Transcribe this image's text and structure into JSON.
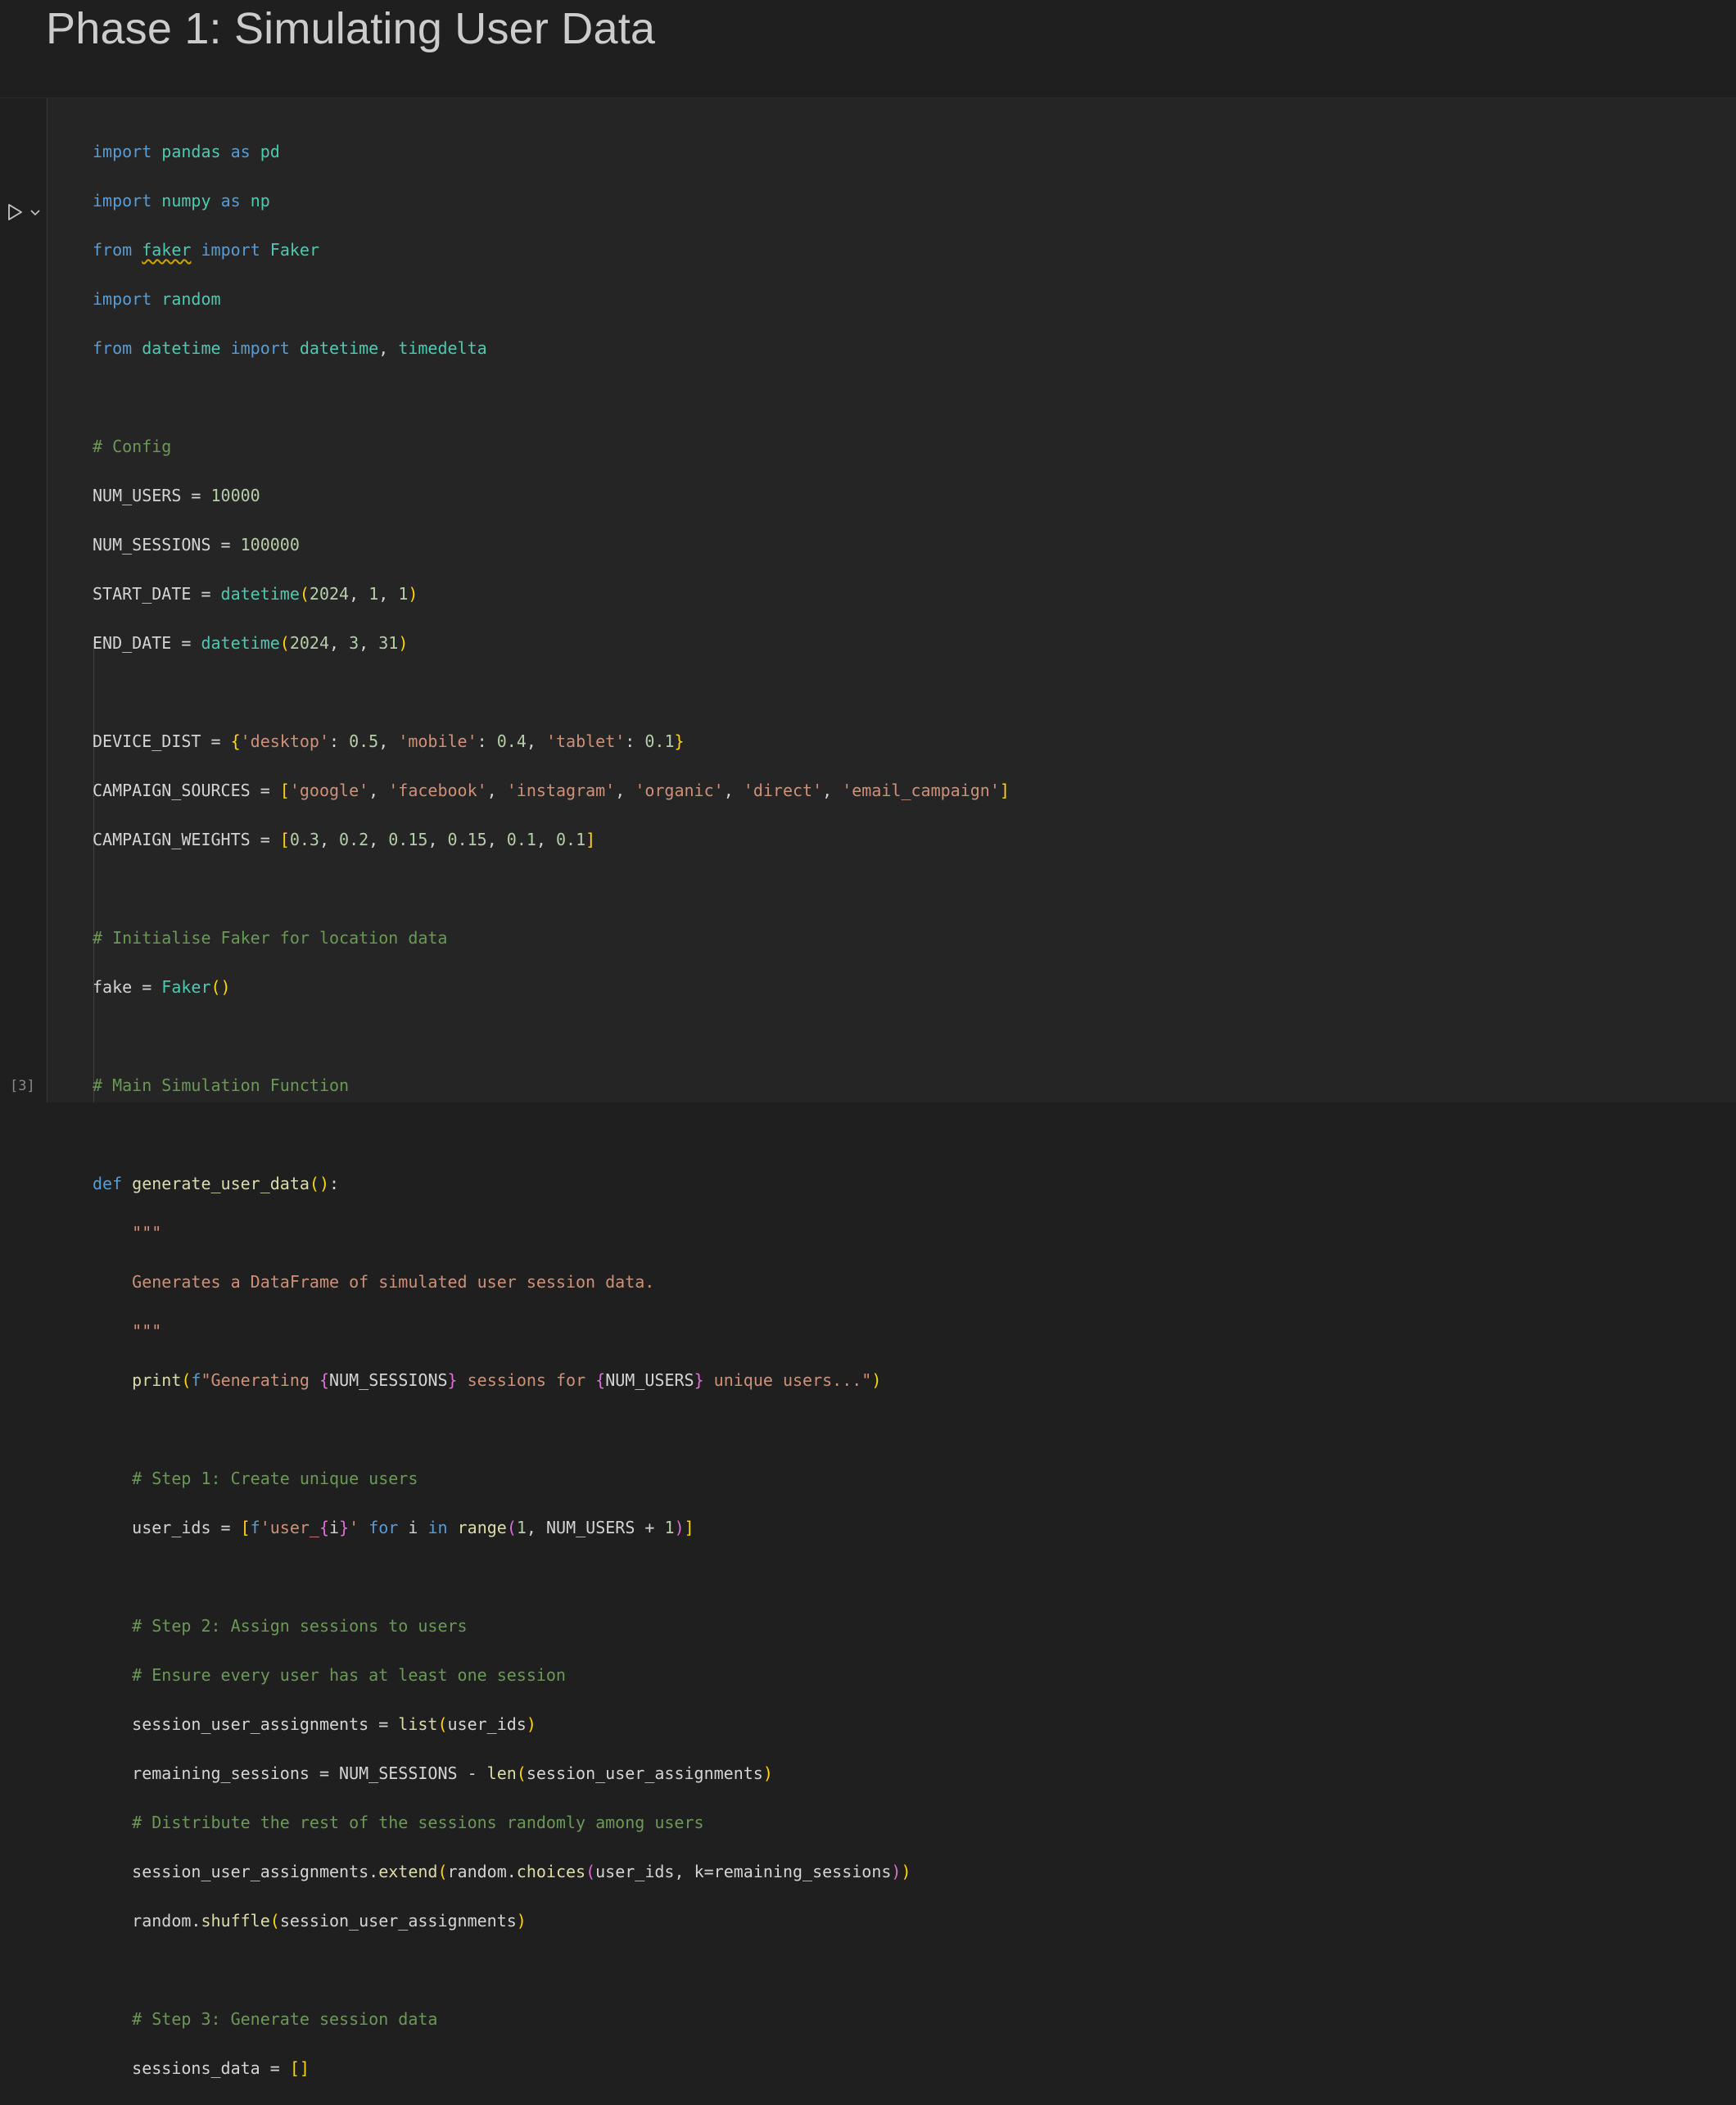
{
  "heading": {
    "title": "Phase 1: Simulating User Data"
  },
  "cell": {
    "execution_count": "[3]",
    "tokens": {
      "import": "import",
      "from": "from",
      "as": "as",
      "def": "def",
      "for": "for",
      "in": "in",
      "pandas": "pandas",
      "pd": "pd",
      "numpy": "numpy",
      "np": "np",
      "faker": "faker",
      "Faker": "Faker",
      "random": "random",
      "datetime": "datetime",
      "timedelta": "timedelta",
      "comment_config": "# Config",
      "NUM_USERS": "NUM_USERS",
      "num_users_val": "10000",
      "NUM_SESSIONS": "NUM_SESSIONS",
      "num_sessions_val": "100000",
      "START_DATE": "START_DATE",
      "END_DATE": "END_DATE",
      "n2024": "2024",
      "n1": "1",
      "n3": "3",
      "n31": "31",
      "DEVICE_DIST": "DEVICE_DIST",
      "s_desktop": "'desktop'",
      "v_desktop": "0.5",
      "s_mobile": "'mobile'",
      "v_mobile": "0.4",
      "s_tablet": "'tablet'",
      "v_tablet": "0.1",
      "CAMPAIGN_SOURCES": "CAMPAIGN_SOURCES",
      "s_google": "'google'",
      "s_facebook": "'facebook'",
      "s_instagram": "'instagram'",
      "s_organic": "'organic'",
      "s_direct": "'direct'",
      "s_email": "'email_campaign'",
      "CAMPAIGN_WEIGHTS": "CAMPAIGN_WEIGHTS",
      "w1": "0.3",
      "w2": "0.2",
      "w3": "0.15",
      "w4": "0.15",
      "w5": "0.1",
      "w6": "0.1",
      "comment_faker": "# Initialise Faker for location data",
      "fake": "fake",
      "comment_main": "# Main Simulation Function",
      "generate_user_data": "generate_user_data",
      "docquote": "\"\"\"",
      "docstring": "Generates a DataFrame of simulated user session data.",
      "print": "print",
      "fprefix": "f",
      "str_generating": "\"Generating ",
      "str_sessions_for": " sessions for ",
      "str_unique": " unique users...\"",
      "comment_step1": "# Step 1: Create unique users",
      "user_ids": "user_ids",
      "str_user_prefix": "'user_",
      "var_i": "i",
      "str_quote": "'",
      "range": "range",
      "comment_step2": "# Step 2: Assign sessions to users",
      "comment_step2b": "# Ensure every user has at least one session",
      "session_user_assignments": "session_user_assignments",
      "list": "list",
      "remaining_sessions": "remaining_sessions",
      "len": "len",
      "comment_distribute": "# Distribute the rest of the sessions randomly among users",
      "extend": "extend",
      "choices": "choices",
      "k_param": "k",
      "shuffle": "shuffle",
      "comment_step3": "# Step 3: Generate session data",
      "sessions_data": "sessions_data"
    }
  }
}
